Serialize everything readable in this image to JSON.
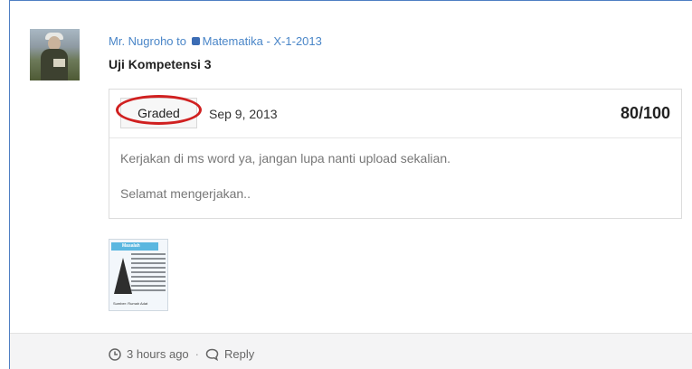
{
  "post": {
    "author": "Mr. Nugroho",
    "to_word": "to",
    "class_name": "Matematika - X-1-2013",
    "title": "Uji Kompetensi 3"
  },
  "card": {
    "status_button": "Graded",
    "date": "Sep 9, 2013",
    "score": "80/100",
    "body_lines": [
      "Kerjakan di ms word ya, jangan lupa nanti upload sekalian.",
      "Selamat mengerjakan.."
    ]
  },
  "attachment": {
    "banner": "Masalah",
    "caption": "Sumber:    Rumah Adat"
  },
  "footer": {
    "time": "3 hours ago",
    "separator": "·",
    "reply": "Reply"
  },
  "colors": {
    "accent": "#4a86c8",
    "annotation_ring": "#d02020",
    "footer_bg": "#f4f4f5"
  },
  "icons": [
    "clock-icon",
    "reply-icon",
    "class-icon"
  ]
}
